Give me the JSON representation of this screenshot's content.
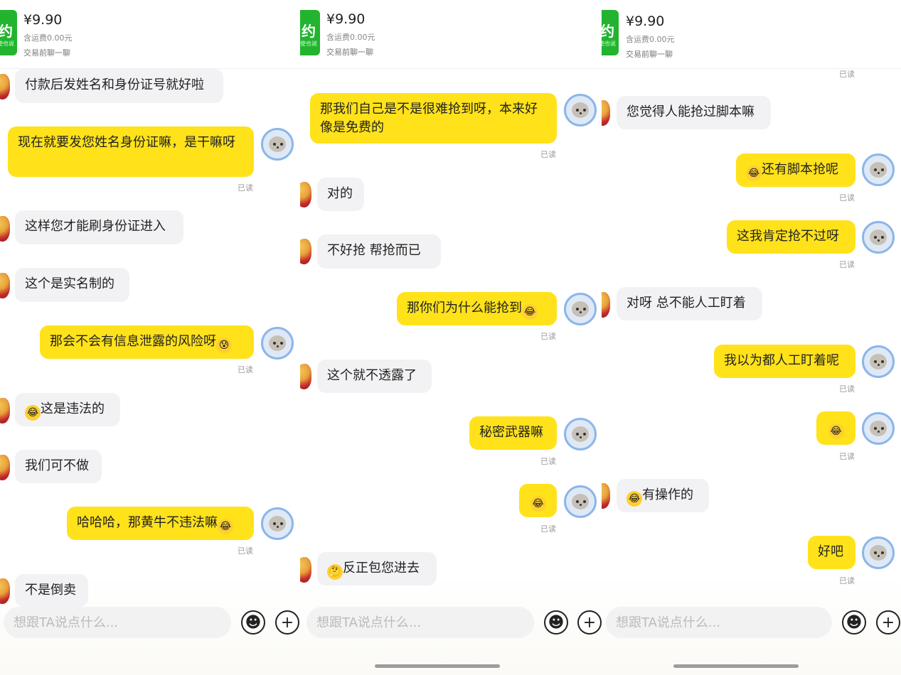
{
  "product": {
    "price": "¥9.90",
    "shipping": "含运费0.00元",
    "chat_note": "交易前聊一聊",
    "thumb_text": "约",
    "thumb_sub": "即使也说"
  },
  "input": {
    "placeholder": "想跟TA说点什么..."
  },
  "icons": {
    "emoji_button": "smiley-face-icon",
    "plus_button": "plus-icon"
  },
  "colors": {
    "outgoing_bubble": "#ffe21a",
    "incoming_bubble": "#f2f2f4",
    "thumb": "#22b42e"
  },
  "read_label": "已读",
  "panel1": {
    "m1": "付款后发姓名和身份证号就好啦",
    "m2": "现在就要发您姓名身份证嘛，是干嘛呀",
    "m3": "这样您才能刷身份证进入",
    "m4": "这个是实名制的",
    "m5": "那会不会有信息泄露的风险呀",
    "m6": "这是违法的",
    "m7": "我们可不做",
    "m8": "哈哈哈，那黄牛不违法嘛",
    "m9": "不是倒卖"
  },
  "panel2": {
    "m1": "那我们自己是不是很难抢到呀，本来好像是免费的",
    "m2": "对的",
    "m3": "不好抢  帮抢而已",
    "m4": "那你们为什么能抢到",
    "m5": "这个就不透露了",
    "m6": "秘密武器嘛",
    "m7": "反正包您进去"
  },
  "panel3": {
    "m1": "您觉得人能抢过脚本嘛",
    "m2": "还有脚本抢呢",
    "m3": "这我肯定抢不过呀",
    "m4": "对呀 总不能人工盯着",
    "m5": "我以为都人工盯着呢",
    "m6": "有操作的",
    "m7": "好吧"
  }
}
